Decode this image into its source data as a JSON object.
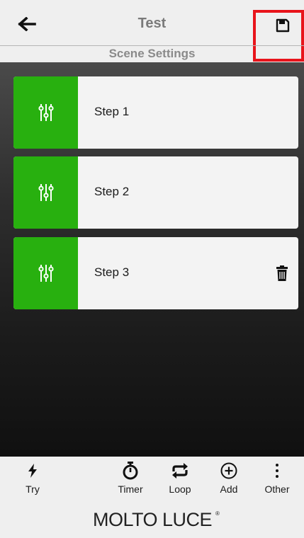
{
  "header": {
    "title": "Test",
    "subtitle": "Scene Settings"
  },
  "icons": {
    "back": "arrow-left-icon",
    "save": "floppy-disk-icon",
    "step": "sliders-icon",
    "delete": "trash-icon"
  },
  "colors": {
    "accent": "#28b00f",
    "highlight": "#e8141b"
  },
  "steps": [
    {
      "label": "Step 1"
    },
    {
      "label": "Step 2"
    },
    {
      "label": "Step 3"
    }
  ],
  "toolbar": {
    "try_label": "Try",
    "timer_label": "Timer",
    "loop_label": "Loop",
    "add_label": "Add",
    "other_label": "Other"
  },
  "brand": {
    "name": "MOLTO LUCE"
  }
}
